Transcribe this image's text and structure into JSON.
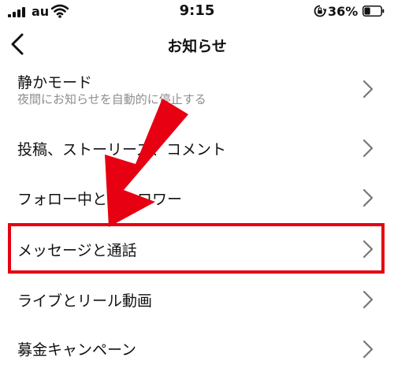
{
  "status_bar": {
    "carrier": "au",
    "time": "9:15",
    "battery": "36%",
    "battery_level": 0.36
  },
  "nav": {
    "title": "お知らせ",
    "back_icon": "chevron-left-icon"
  },
  "items": [
    {
      "label": "静かモード",
      "sublabel": "夜間にお知らせを自動的に停止する"
    },
    {
      "label": "投稿、ストーリーズ、コメント"
    },
    {
      "label": "フォロー中とフォロワー"
    },
    {
      "label": "メッセージと通話"
    },
    {
      "label": "ライブとリール動画"
    },
    {
      "label": "募金キャンペーン"
    }
  ],
  "annotation": {
    "highlight_color": "#e60012",
    "highlighted_item": "メッセージと通話"
  }
}
